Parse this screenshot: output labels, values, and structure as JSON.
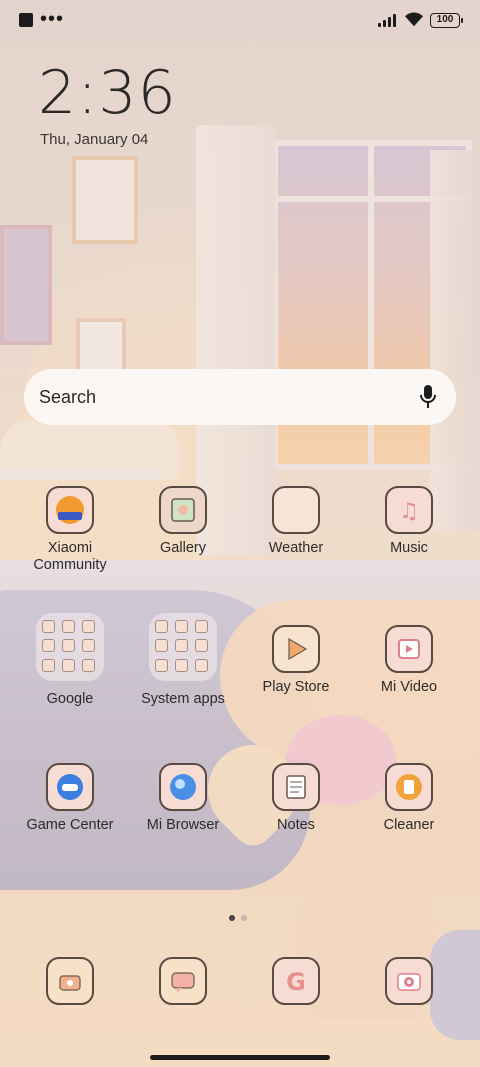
{
  "status_bar": {
    "battery": "100"
  },
  "clock": {
    "time": "2:36",
    "date": "Thu, January 04"
  },
  "search": {
    "label": "Search"
  },
  "apps": {
    "xiaomi_community": "Xiaomi Community",
    "gallery": "Gallery",
    "weather": "Weather",
    "music": "Music",
    "google": "Google",
    "system_apps": "System apps",
    "play_store": "Play Store",
    "mi_video": "Mi Video",
    "game_center": "Game Center",
    "mi_browser": "Mi Browser",
    "notes": "Notes",
    "cleaner": "Cleaner"
  },
  "dock": [
    "Phone",
    "Messages",
    "Google",
    "Camera"
  ],
  "pager": {
    "current": 1,
    "total": 2
  },
  "colors": {
    "icon_bg": "#f6dcd3",
    "icon_border": "#5a4a44",
    "accent_blue": "#3b7fe0",
    "accent_orange": "#f2a23a"
  }
}
